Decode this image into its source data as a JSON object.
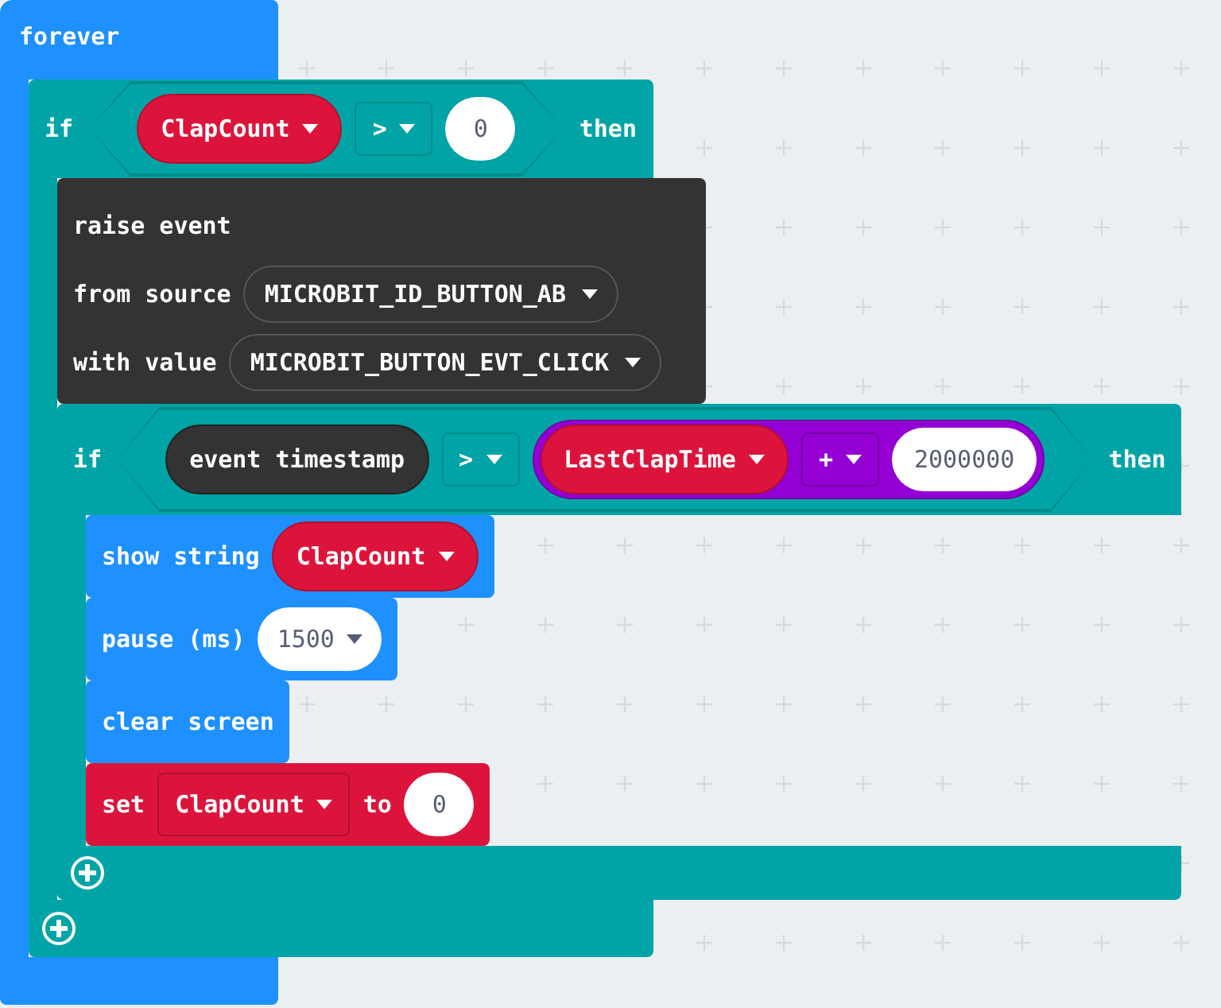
{
  "forever": {
    "label": "forever",
    "body": [
      {
        "kind": "if",
        "label": "if",
        "then_label": "then",
        "condition": {
          "left": {
            "kind": "variable",
            "text": "ClapCount"
          },
          "operator": ">",
          "right": {
            "kind": "number",
            "text": "0"
          }
        },
        "body": [
          {
            "kind": "event",
            "label": "raise event",
            "params": [
              {
                "label": "from source",
                "value": "MICROBIT_ID_BUTTON_AB"
              },
              {
                "label": "with value",
                "value": "MICROBIT_BUTTON_EVT_CLICK"
              }
            ]
          },
          {
            "kind": "if",
            "label": "if",
            "then_label": "then",
            "condition": {
              "left": {
                "kind": "reporter",
                "text": "event timestamp"
              },
              "operator": ">",
              "right": {
                "kind": "math",
                "left": {
                  "kind": "variable",
                  "text": "LastClapTime"
                },
                "operator": "+",
                "right": {
                  "kind": "number",
                  "text": "2000000"
                }
              }
            },
            "body": [
              {
                "kind": "basic",
                "parts": [
                  {
                    "kind": "label",
                    "text": "show string"
                  },
                  {
                    "kind": "variable",
                    "text": "ClapCount"
                  }
                ]
              },
              {
                "kind": "basic",
                "parts": [
                  {
                    "kind": "label",
                    "text": "pause (ms)"
                  },
                  {
                    "kind": "number_dropdown",
                    "text": "1500"
                  }
                ]
              },
              {
                "kind": "basic",
                "parts": [
                  {
                    "kind": "label",
                    "text": "clear screen"
                  }
                ]
              },
              {
                "kind": "variables",
                "parts": [
                  {
                    "kind": "label",
                    "text": "set"
                  },
                  {
                    "kind": "var_dropdown",
                    "text": "ClapCount"
                  },
                  {
                    "kind": "label",
                    "text": "to"
                  },
                  {
                    "kind": "number",
                    "text": "0"
                  }
                ]
              }
            ]
          }
        ]
      }
    ]
  }
}
